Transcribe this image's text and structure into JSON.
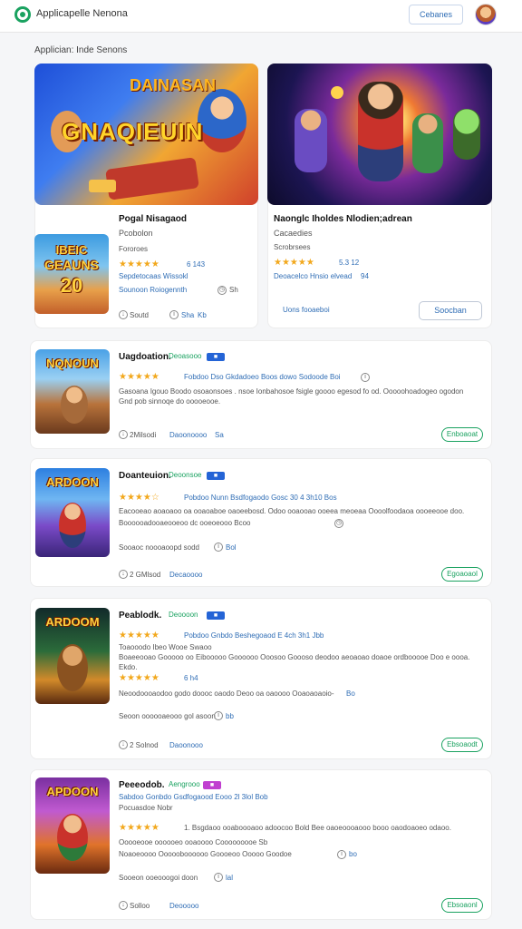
{
  "header": {
    "title": "Applicapelle Nenona",
    "action_label": "Cebanes",
    "logo_icon": "circle-logo-icon",
    "accent": "#1aa260"
  },
  "section": {
    "title": "Applician: Inde Senons"
  },
  "featured": [
    {
      "banner_top": "DAINASAN",
      "banner_main": "GNAQIEUIN",
      "name": "Pogal Nisagaod",
      "subtitle": "Pcobolon",
      "meta": "Fororoes",
      "rating_text": "6 143",
      "tags": "Sepdetocaas Wissokl",
      "dev": "Sounoon Roiogennth",
      "dev_count": "Sh",
      "footer_a": "Soutd",
      "footer_b": "Sha",
      "footer_c": "Kb",
      "thumb_label_top": "IBEIC",
      "thumb_label_mid": "GEAUNS",
      "thumb_label_num": "20"
    },
    {
      "name": "Naonglc Iholdes Nlodien;adrean",
      "subtitle": "Cacaedies",
      "meta": "Scrobrsees",
      "rating_text": "5.3 12",
      "tags": "Deoacelco Hnsio elvead",
      "tags_count": "94",
      "link": "Uons fooaeboi",
      "button": "Soocban"
    }
  ],
  "list": [
    {
      "title": "Uagdoation.",
      "category": "Deoasooo",
      "badge": "■",
      "rating_line": "Fobdoo Dso Gkdadoeo Boos dowo Sodoode Boi",
      "desc_1": "Gasoana Igouo Boodo osoaonsoes . nsoe Ionbahosoe fsigle goooo egesod fo od. Ooooohoadogeo ogodon ooegoro.",
      "desc_2": "Gnd pob sinnoqe do ooooeooe.",
      "footer_a": "2Milsodi",
      "footer_b": "Daoonoooo",
      "footer_c": "Sa",
      "install": "Enboaoat",
      "thumb_label": "NQNOUN"
    },
    {
      "title": "Doanteuion.",
      "category": "Deoonsoe",
      "badge": "■",
      "rating_line": "Pobdoo Nunn Bsdfogaodo Gosc 30 4 3h10 Bos",
      "desc_1": "Eacooeao aoaoaoo oa ooaoaboe oaoeebosd. Odoo ooaooao ooeea meoeaa Oooolfoodaoa oooeeooe doo.",
      "desc_2": "Boooooadooaeooeoo dc ooeoeooo Bcoo",
      "link_a": "Sooaoc noooaoopd sodd",
      "link_a_num": "Bol",
      "footer_a": "2 GMlsod",
      "footer_b": "Decaoooo",
      "install": "Egoaoaol",
      "thumb_label": "ARDOON"
    },
    {
      "title": "Peablodk.",
      "category": "Deoooon",
      "badge": "■",
      "rating_line": "Pobdoo Gnbdo Beshegoaod E 4ch 3h1 Jbb",
      "desc_1": "Toaooodo Ibeo Wooe Swaoo",
      "desc_2": "Boaeeooao Gooooo oo Eibooooo Goooooo Ooosoo Goooso deodoo aeoaoao doaoe ordbooooe Doo e oooa.",
      "desc_3": "Ekdo.",
      "rating_text_2": "6 h4",
      "link_a": "Neoodoooaodoo godo doooc oaodo Deoo oa oaoooo Ooaoaoaoio-",
      "link_a_num": "Bo",
      "link_b": "Seoon oooooaeooo gol asoon",
      "link_b_num": "bb",
      "footer_a": "2 Solnod",
      "footer_b": "Daoonooo",
      "install": "Ebsoaodt",
      "thumb_label": "ARDOOM"
    },
    {
      "title": "Peeeodob.",
      "category": "Aengrooo",
      "badge": "■",
      "rating_line": "Sabdoo Gonbdo Gsdfogaood Eooo 2l 3lol Bob",
      "sub_line": "Pocuasdoe Nobr",
      "rating_desc": "1. Bsgdaoo ooaboooaoo adoocoo Bold Bee oaoeoooaooo booo oaodoaoeo odaoo.",
      "desc_1": "Ooooeooe oooooeo ooaoooo Cooooooooe Sb",
      "desc_2": "Noaoeoooo Oooooboooooo Goooeoo Ooooo Goodoe",
      "desc_2_num": "bo",
      "link_a": "Sooeon ooeooogoi doon",
      "link_a_num": "lal",
      "footer_a": "Solloo",
      "footer_b": "Deooooo",
      "install": "Ebsoaonl",
      "thumb_label": "APDOON"
    }
  ],
  "colors": {
    "accent_green": "#1aa260",
    "link_blue": "#2f6db5",
    "star": "#f2a81d",
    "badge_blue": "#2464d6",
    "badge_purple": "#c03fd0"
  }
}
